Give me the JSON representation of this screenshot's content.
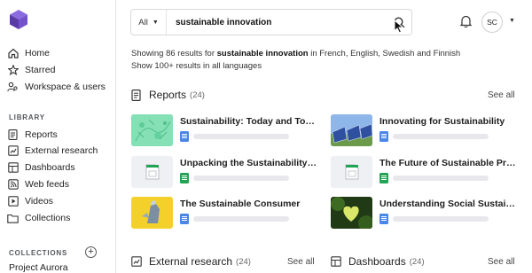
{
  "sidebar": {
    "nav": [
      {
        "label": "Home",
        "icon": "home-icon"
      },
      {
        "label": "Starred",
        "icon": "star-icon"
      },
      {
        "label": "Workspace & users",
        "icon": "users-icon"
      }
    ],
    "library_label": "LIBRARY",
    "library": [
      {
        "label": "Reports",
        "icon": "report-icon"
      },
      {
        "label": "External research",
        "icon": "external-research-icon"
      },
      {
        "label": "Dashboards",
        "icon": "dashboard-icon"
      },
      {
        "label": "Web feeds",
        "icon": "rss-icon"
      },
      {
        "label": "Videos",
        "icon": "video-icon"
      },
      {
        "label": "Collections",
        "icon": "folder-icon"
      }
    ],
    "collections_label": "COLLECTIONS",
    "project": "Project Aurora"
  },
  "header": {
    "scope": "All",
    "query": "sustainable innovation",
    "avatar_initials": "SC"
  },
  "summary": {
    "prefix": "Showing 86 results for ",
    "query": "sustainable innovation",
    "suffix": " in French, English, Swedish and Finnish",
    "more": "Show 100+ results in all languages"
  },
  "reports": {
    "title": "Reports",
    "count": "(24)",
    "see_all": "See all",
    "items": [
      {
        "title": "Sustainability: Today and Tomorrow",
        "doc": "blue"
      },
      {
        "title": "Innovating for Sustainability",
        "doc": "blue"
      },
      {
        "title": "Unpacking the Sustainability Report",
        "doc": "green"
      },
      {
        "title": "The Future of Sustainable Products",
        "doc": "green"
      },
      {
        "title": "The Sustainable Consumer",
        "doc": "blue"
      },
      {
        "title": "Understanding Social Sustainability",
        "doc": "blue"
      }
    ]
  },
  "external_research": {
    "title": "External research",
    "count": "(24)",
    "see_all": "See all"
  },
  "dashboards": {
    "title": "Dashboards",
    "count": "(24)",
    "see_all": "See all"
  },
  "colors": {
    "accent": "#6d4bc3",
    "doc_blue": "#4a86e8",
    "doc_green": "#23a455"
  }
}
